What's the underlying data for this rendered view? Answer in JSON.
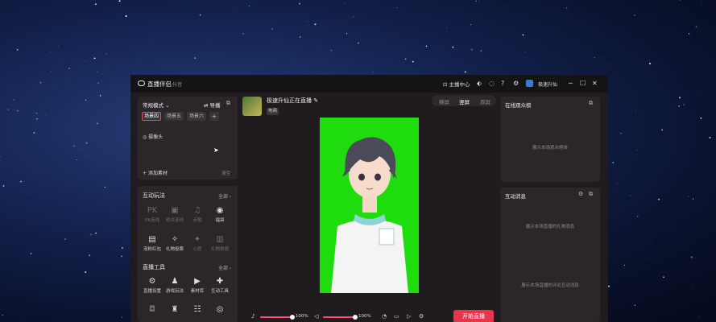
{
  "app": {
    "title": "直播伴侣",
    "platform": "抖音",
    "host_center": "主播中心",
    "upgrade": "极速升仙"
  },
  "left": {
    "mode": "常规模式",
    "guide": "导播",
    "scenes": [
      "场景四",
      "场景五",
      "场景六"
    ],
    "add_scene": "+",
    "source_camera": "摄像头",
    "add_material": "添加素材",
    "clear": "清空"
  },
  "interactive": {
    "title": "互动玩法",
    "all": "全部",
    "items": [
      {
        "label": "PK连线",
        "icon": "PK",
        "enabled": false
      },
      {
        "label": "观众连线",
        "icon": "▣",
        "enabled": false
      },
      {
        "label": "点歌",
        "icon": "♫",
        "enabled": false
      },
      {
        "label": "福袋",
        "icon": "◉",
        "enabled": true
      },
      {
        "label": "宠粉红包",
        "icon": "▤",
        "enabled": true
      },
      {
        "label": "礼物投票",
        "icon": "✧",
        "enabled": true
      },
      {
        "label": "心愿",
        "icon": "✦",
        "enabled": false
      },
      {
        "label": "礼物数据",
        "icon": "▥",
        "enabled": false
      }
    ]
  },
  "live_tools": {
    "title": "直播工具",
    "all": "全部",
    "items": [
      {
        "label": "直播设置",
        "icon": "⚙",
        "enabled": true
      },
      {
        "label": "游戏玩法",
        "icon": "♟",
        "enabled": true
      },
      {
        "label": "素材库",
        "icon": "▶",
        "enabled": true
      },
      {
        "label": "互动工具",
        "icon": "✚",
        "enabled": true
      }
    ],
    "more_icons": [
      "◘",
      "♜",
      "☷",
      "◎"
    ]
  },
  "stream": {
    "title": "极速升仙正在直播",
    "tag": "电商",
    "orientation_tabs": [
      "横屏",
      "竖屏",
      "双屏"
    ],
    "active_tab": 1
  },
  "bottom": {
    "mic_volume": 100,
    "mic_label": "100%",
    "speaker_volume": 100,
    "speaker_label": "100%",
    "start": "开始直播"
  },
  "right": {
    "viewers_title": "在线观众榜",
    "viewers_empty": "展示本场观众榜单",
    "messages_title": "互动消息",
    "gift_empty": "展示本场直播的礼物消息",
    "comment_empty": "展示本场直播的评论互动消息"
  },
  "colors": {
    "accent": "#e8354d",
    "greenscreen": "#1fdc0f"
  }
}
